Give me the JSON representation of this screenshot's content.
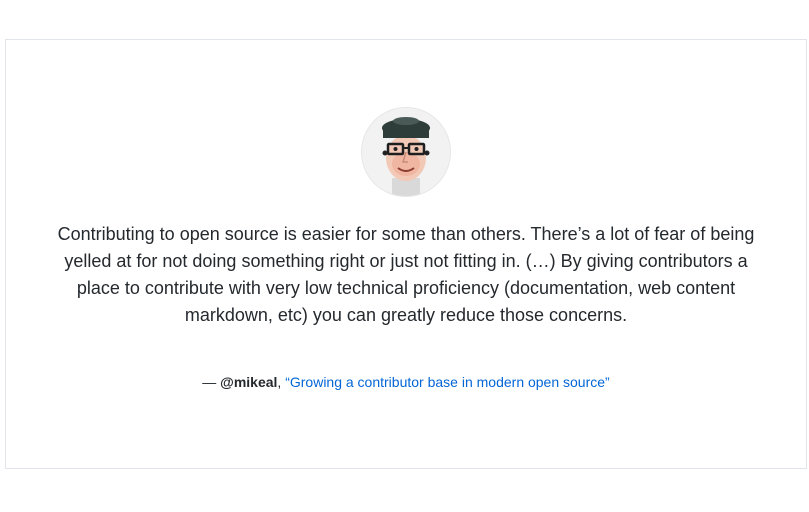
{
  "testimonial": {
    "avatar_icon": "mikeal-avatar-icon",
    "quote": "Contributing to open source is easier for some than others. There’s a lot of fear of being yelled at for not doing something right or just not fitting in. (…) By giving contributors a place to contribute with very low technical proficiency (documentation, web content markdown, etc) you can greatly reduce those concerns.",
    "dash": "— ",
    "author": "@mikeal",
    "separator": ", ",
    "source_link": "“Growing a contributor base in modern open source”"
  },
  "colors": {
    "text": "#24292e",
    "link": "#0366d6",
    "border": "#e1e4e8"
  }
}
